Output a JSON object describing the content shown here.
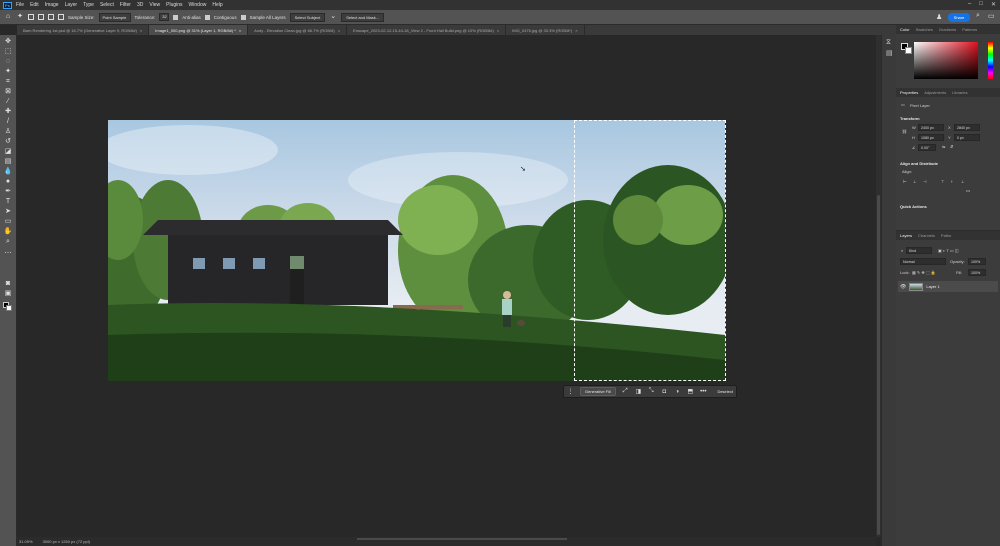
{
  "menubar": {
    "logo": "Ps",
    "items": [
      "File",
      "Edit",
      "Image",
      "Layer",
      "Type",
      "Select",
      "Filter",
      "3D",
      "View",
      "Plugins",
      "Window",
      "Help"
    ],
    "window_controls": [
      "–",
      "□",
      "✕"
    ]
  },
  "options": {
    "sample_label": "Sample Size:",
    "sample_value": "Point Sample",
    "tolerance_label": "Tolerance:",
    "tolerance_value": "32",
    "antialias_label": "Anti-alias",
    "contiguous_label": "Contiguous",
    "sample_all_label": "Sample All Layers",
    "select_subject_label": "Select Subject",
    "select_mask_label": "Select and Mask...",
    "share_label": "Share"
  },
  "tabs": [
    {
      "label": "Barn Rendering 1st.psd @ 16.7% (Generative Layer 9, RGB/8#)",
      "active": false
    },
    {
      "label": "Image1_000.png @ 31% (Layer 1, RGB/8#) *",
      "active": true
    },
    {
      "label": "Andy - Elevation Clean.jpg @ 66.7% (RGB/8)",
      "active": false
    },
    {
      "label": "Enscape_2023-02-12-15-44-18_View 2 - Front Hall Build.png @ 10% (RGB/8#)",
      "active": false
    },
    {
      "label": "IMG_0476.jpg @ 33.3% (RGB/8*)",
      "active": false
    }
  ],
  "taskbar": {
    "generative_fill": "Generative Fill",
    "more": "•••",
    "deselect": "Deselect"
  },
  "status": {
    "zoom": "31.09%",
    "doc_size": "3000 px x 1260 px (72 ppi)"
  },
  "color_panel": {
    "tabs": [
      "Color",
      "Swatches",
      "Gradients",
      "Patterns"
    ],
    "accent": "#e0101f"
  },
  "properties": {
    "tabs": [
      "Properties",
      "Adjustments",
      "Libraries"
    ],
    "layer_type": "Pixel Layer",
    "transform_head": "Transform",
    "w_label": "W",
    "w_value": "2400 px",
    "x_label": "X",
    "x_value": "2840 px",
    "h_label": "H",
    "h_value": "1080 px",
    "y_label": "Y",
    "y_value": "0 px",
    "angle_value": "0.00°",
    "align_head": "Align and Distribute",
    "align_label": "Align:",
    "quick_head": "Quick Actions",
    "more_dots": "•••"
  },
  "layers": {
    "tabs": [
      "Layers",
      "Channels",
      "Paths"
    ],
    "filter_label": "Kind",
    "blend_mode": "Normal",
    "opacity_label": "Opacity:",
    "opacity_value": "100%",
    "lock_label": "Lock:",
    "fill_label": "Fill:",
    "fill_value": "100%",
    "layer_name": "Layer 1"
  }
}
